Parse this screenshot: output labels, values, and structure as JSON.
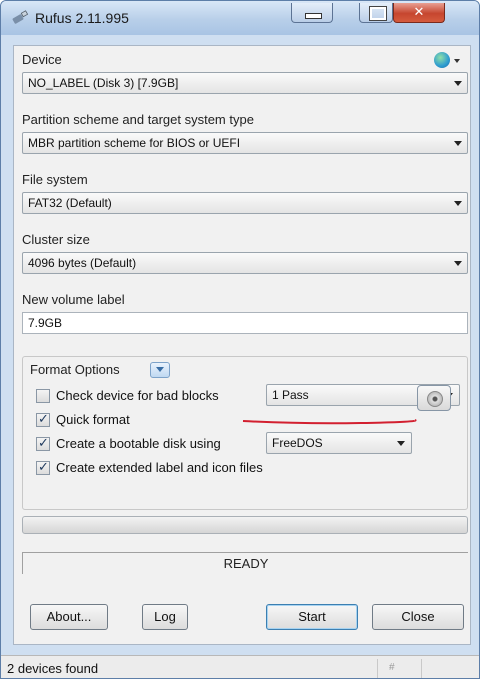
{
  "window": {
    "title": "Rufus 2.11.995",
    "app_icon": "usb-drive-icon",
    "controls": [
      "minimize-icon",
      "maximize-icon",
      "close-icon"
    ]
  },
  "device": {
    "label": "Device",
    "value": "NO_LABEL (Disk 3) [7.9GB]",
    "language_icon": "globe-icon"
  },
  "partition": {
    "label": "Partition scheme and target system type",
    "value": "MBR partition scheme for BIOS or UEFI"
  },
  "filesystem": {
    "label": "File system",
    "value": "FAT32 (Default)"
  },
  "cluster": {
    "label": "Cluster size",
    "value": "4096 bytes (Default)"
  },
  "volume": {
    "label": "New volume label",
    "value": "7.9GB"
  },
  "format_options": {
    "title": "Format Options",
    "check_bad_blocks": {
      "label": "Check device for bad blocks",
      "checked": false,
      "passes": "1 Pass"
    },
    "quick_format": {
      "label": "Quick format",
      "checked": true
    },
    "bootable": {
      "label": "Create a bootable disk using",
      "checked": true,
      "value": "FreeDOS",
      "browse_icon": "disk-image-icon"
    },
    "extended_label": {
      "label": "Create extended label and icon files",
      "checked": true
    }
  },
  "progress": {
    "fraction": 0
  },
  "status": {
    "text": "READY"
  },
  "buttons": {
    "about": "About...",
    "log": "Log",
    "start": "Start",
    "close": "Close"
  },
  "statusbar": {
    "text": "2 devices found",
    "hash": "#"
  },
  "colors": {
    "titlebar": "#b8cfe9",
    "panel": "#f1f1f1",
    "annotation_underline": "#d21f2f"
  }
}
